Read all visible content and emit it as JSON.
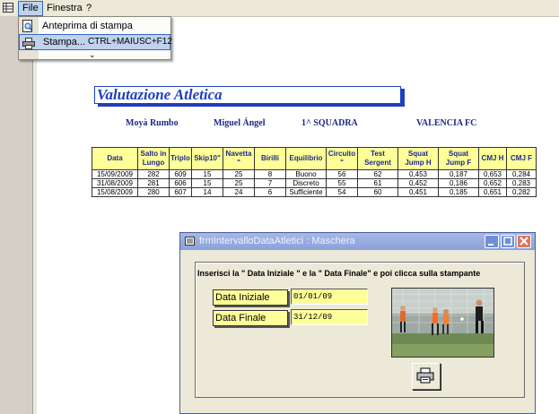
{
  "menubar": {
    "items": [
      {
        "label": "File"
      },
      {
        "label": "Finestra"
      },
      {
        "label": "?"
      }
    ]
  },
  "file_menu": {
    "items": [
      {
        "label": "Anteprima di stampa",
        "icon": "print-preview-icon"
      },
      {
        "label": "Stampa...",
        "shortcut": "CTRL+MAIUSC+F12",
        "icon": "printer-icon"
      }
    ],
    "more_indicator": "⌄"
  },
  "report": {
    "title": "Valutazione Atletica",
    "surname": "Moyà Rumbo",
    "name": "Miguel Ángel",
    "team": "1^ SQUADRA",
    "club": "VALENCIA FC",
    "columns": [
      "Data",
      "Salto in Lungo",
      "Triplo",
      "Skip10\"",
      "Navetta \"",
      "Birilli",
      "Equilibrio",
      "Circuito \"",
      "Test Sergent",
      "Squat Jump H",
      "Squat Jump F",
      "CMJ H",
      "CMJ F"
    ],
    "rows": [
      [
        "15/09/2009",
        "282",
        "609",
        "15",
        "25",
        "8",
        "Buono",
        "56",
        "62",
        "0,453",
        "0,187",
        "0,653",
        "0,284"
      ],
      [
        "31/08/2009",
        "281",
        "606",
        "15",
        "25",
        "7",
        "Discreto",
        "55",
        "61",
        "0,452",
        "0,186",
        "0,652",
        "0,283"
      ],
      [
        "15/08/2009",
        "280",
        "607",
        "14",
        "24",
        "6",
        "Sufficiente",
        "54",
        "60",
        "0,451",
        "0,185",
        "0,651",
        "0,282"
      ]
    ]
  },
  "dialog": {
    "title": "frmIntervalloDataAtletici : Maschera",
    "instruction": "Inserisci la \" Data Iniziale \" e la \" Data Finale\" e poi clicca sulla stampante",
    "start_label": "Data Iniziale",
    "start_value": "01/01/09",
    "end_label": "Data Finale",
    "end_value": "31/12/09"
  },
  "colors": {
    "title_blue": "#1f3fbf",
    "header_yellow": "#ffff99",
    "xp_menu_bg": "#ece9d8"
  }
}
